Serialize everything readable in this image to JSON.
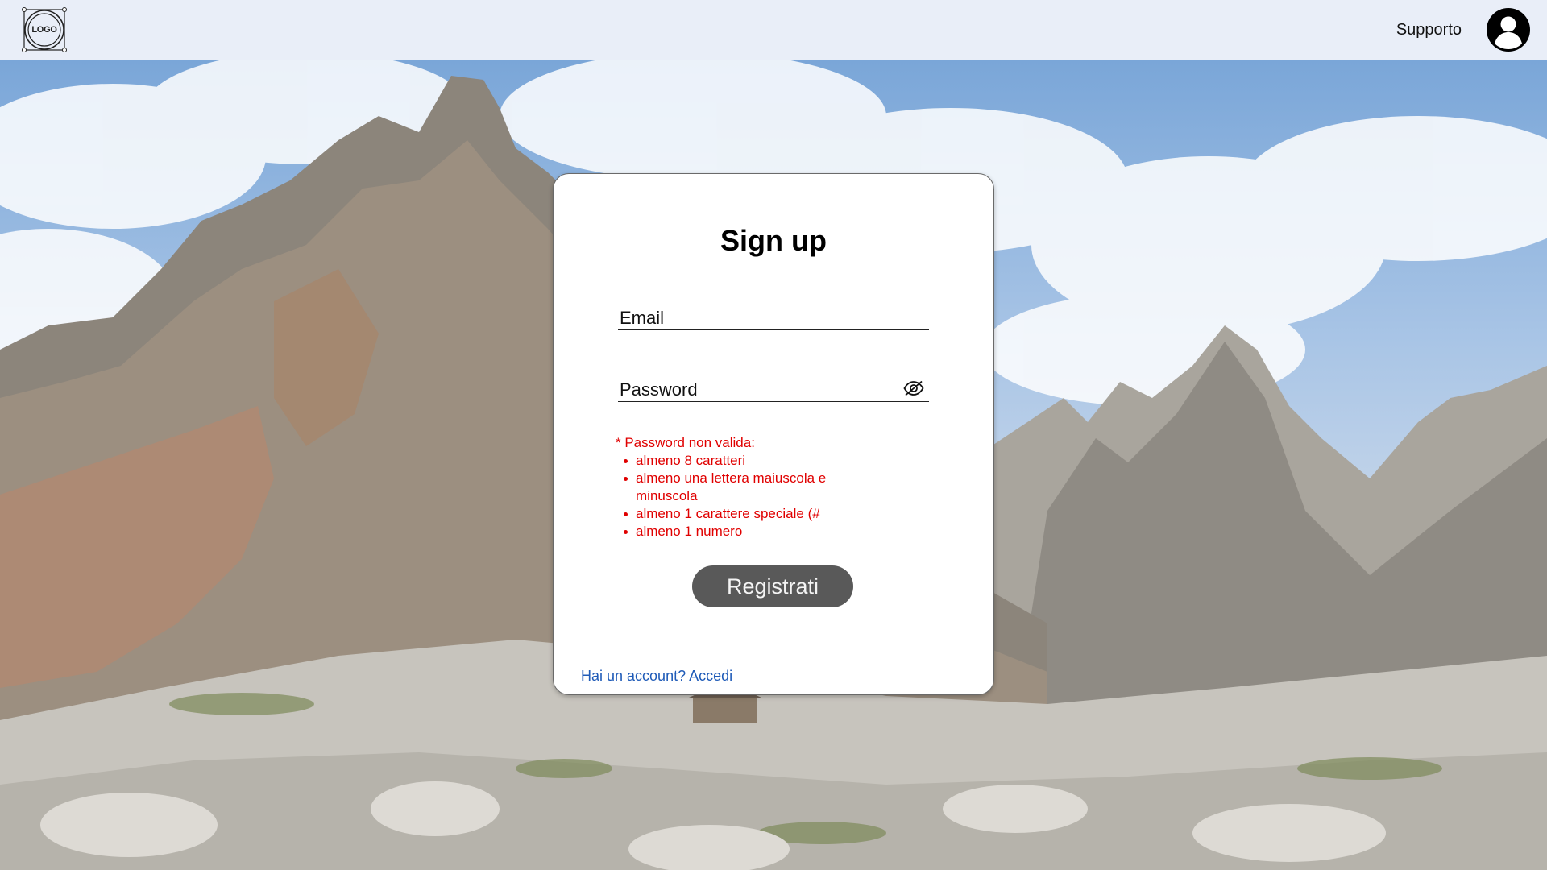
{
  "header": {
    "logo_text": "LOGO",
    "support_label": "Supporto"
  },
  "signup": {
    "title": "Sign up",
    "email_placeholder": "Email",
    "password_placeholder": "Password",
    "error_title": "* Password non valida:",
    "errors": [
      "almeno 8 caratteri",
      "almeno una lettera maiuscola e minuscola",
      "almeno 1 carattere speciale (#",
      "almeno 1 numero"
    ],
    "submit_label": "Registrati",
    "login_link": "Hai un account? Accedi"
  },
  "colors": {
    "error": "#e00000",
    "button_bg": "#595959",
    "link": "#1f5bb8",
    "header_bg": "#e9eef8"
  },
  "icons": {
    "logo": "logo-icon",
    "avatar": "user-avatar-icon",
    "password_visibility": "eye-off-icon"
  }
}
